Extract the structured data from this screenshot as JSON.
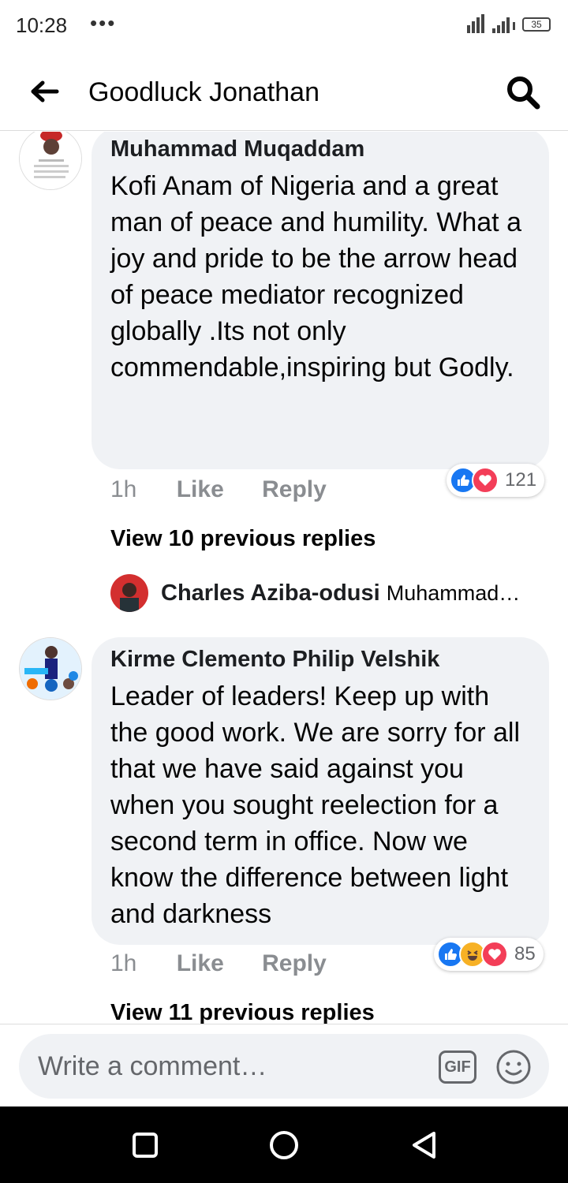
{
  "status_bar": {
    "time": "10:28",
    "dots": "•••",
    "battery": "35"
  },
  "header": {
    "title": "Goodluck Jonathan"
  },
  "comments": [
    {
      "author": "Muhammad Muqaddam",
      "text": "Kofi Anam of Nigeria and a great man of peace and humility. What a joy and pride to be the arrow head of peace mediator recognized globally .Its not only commendable,inspiring but Godly.",
      "time": "1h",
      "like_label": "Like",
      "reply_label": "Reply",
      "reactions": [
        "like",
        "love"
      ],
      "reaction_count": "121",
      "view_replies": "View 10 previous replies",
      "reply_preview": {
        "author": "Charles Aziba-odusi",
        "text": "Muhammad…"
      }
    },
    {
      "author": "Kirme Clemento Philip Velshik",
      "text": "Leader of leaders! Keep up with the good work. We are sorry for all that we have said against you when you sought reelection for a second term in office. Now we know the difference between light and darkness",
      "time": "1h",
      "like_label": "Like",
      "reply_label": "Reply",
      "reactions": [
        "like",
        "haha",
        "love"
      ],
      "reaction_count": "85",
      "view_replies": "View 11 previous replies"
    }
  ],
  "composer": {
    "placeholder": "Write a comment…",
    "gif_label": "GIF"
  },
  "icons": {
    "back": "arrow-left-icon",
    "search": "search-icon",
    "gif": "gif-icon",
    "emoji": "emoji-icon",
    "nav_recents": "square-icon",
    "nav_home": "circle-icon",
    "nav_back": "triangle-back-icon"
  },
  "colors": {
    "like": "#1877f2",
    "love": "#f33e58",
    "haha": "#f7b125",
    "bubble": "#f0f2f5",
    "meta": "#8a8d91"
  }
}
